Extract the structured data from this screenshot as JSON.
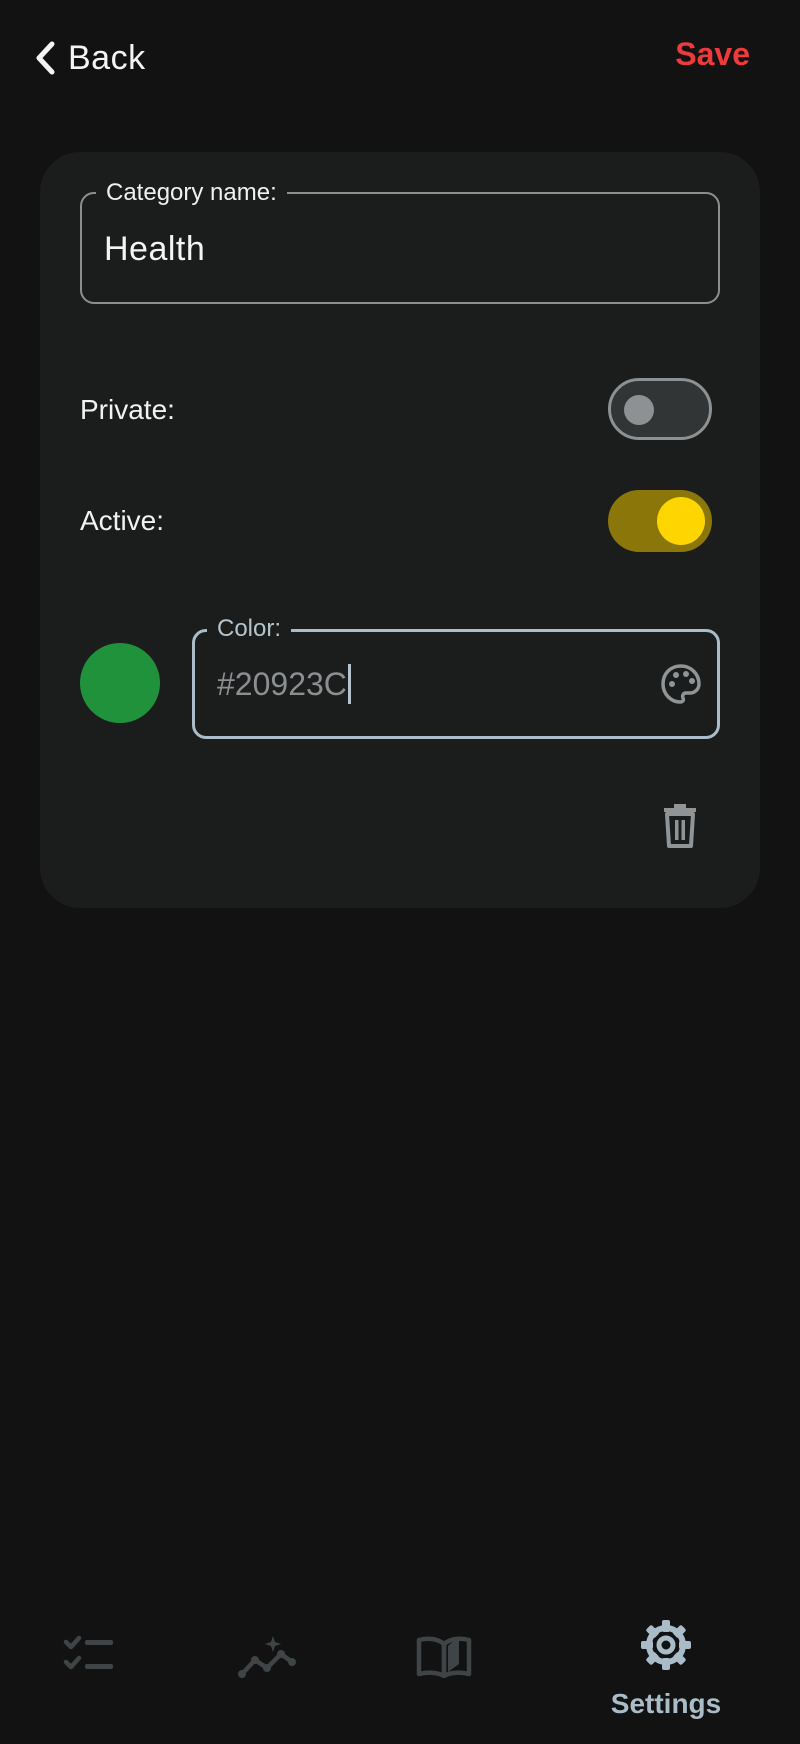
{
  "header": {
    "back_label": "Back",
    "save_label": "Save",
    "save_color": "#ee3a3a"
  },
  "form": {
    "category_name_label": "Category name:",
    "category_name_value": "Health",
    "private_label": "Private:",
    "private_enabled": false,
    "active_label": "Active:",
    "active_enabled": true,
    "color_label": "Color:",
    "color_value": "#20923C",
    "swatch_color": "#20923C",
    "palette_icon": "palette-icon",
    "delete_icon": "trash-icon"
  },
  "bottom_nav": {
    "items": [
      {
        "icon": "checklist-icon",
        "label": ""
      },
      {
        "icon": "stats-sparkle-icon",
        "label": ""
      },
      {
        "icon": "book-icon",
        "label": ""
      },
      {
        "icon": "gear-icon",
        "label": "Settings",
        "active": true
      }
    ],
    "active_color": "#a9bcc7",
    "inactive_color": "#3f4547"
  }
}
